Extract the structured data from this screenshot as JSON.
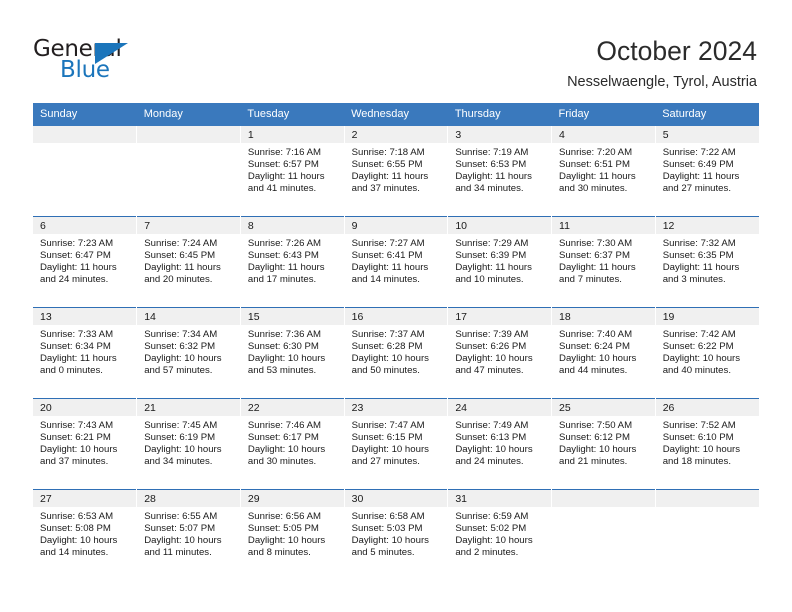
{
  "brand": {
    "name_primary": "General",
    "name_secondary": "Blue",
    "accent_color": "#1b75bb",
    "triangle_icon": "brand-triangle-icon"
  },
  "header": {
    "title": "October 2024",
    "subtitle": "Nesselwaengle, Tyrol, Austria"
  },
  "theme": {
    "header_row_bg": "#3a79bd",
    "week_divider": "#2f6fb5",
    "daynum_strip_bg": "#f0f0f0",
    "text_color": "#1a1a1a"
  },
  "weekdays": [
    "Sunday",
    "Monday",
    "Tuesday",
    "Wednesday",
    "Thursday",
    "Friday",
    "Saturday"
  ],
  "weeks": [
    [
      {
        "day": "",
        "empty": true,
        "sunrise": "",
        "sunset": "",
        "daylight_1": "",
        "daylight_2": ""
      },
      {
        "day": "",
        "empty": true,
        "sunrise": "",
        "sunset": "",
        "daylight_1": "",
        "daylight_2": ""
      },
      {
        "day": "1",
        "empty": false,
        "sunrise": "Sunrise: 7:16 AM",
        "sunset": "Sunset: 6:57 PM",
        "daylight_1": "Daylight: 11 hours",
        "daylight_2": "and 41 minutes."
      },
      {
        "day": "2",
        "empty": false,
        "sunrise": "Sunrise: 7:18 AM",
        "sunset": "Sunset: 6:55 PM",
        "daylight_1": "Daylight: 11 hours",
        "daylight_2": "and 37 minutes."
      },
      {
        "day": "3",
        "empty": false,
        "sunrise": "Sunrise: 7:19 AM",
        "sunset": "Sunset: 6:53 PM",
        "daylight_1": "Daylight: 11 hours",
        "daylight_2": "and 34 minutes."
      },
      {
        "day": "4",
        "empty": false,
        "sunrise": "Sunrise: 7:20 AM",
        "sunset": "Sunset: 6:51 PM",
        "daylight_1": "Daylight: 11 hours",
        "daylight_2": "and 30 minutes."
      },
      {
        "day": "5",
        "empty": false,
        "sunrise": "Sunrise: 7:22 AM",
        "sunset": "Sunset: 6:49 PM",
        "daylight_1": "Daylight: 11 hours",
        "daylight_2": "and 27 minutes."
      }
    ],
    [
      {
        "day": "6",
        "empty": false,
        "sunrise": "Sunrise: 7:23 AM",
        "sunset": "Sunset: 6:47 PM",
        "daylight_1": "Daylight: 11 hours",
        "daylight_2": "and 24 minutes."
      },
      {
        "day": "7",
        "empty": false,
        "sunrise": "Sunrise: 7:24 AM",
        "sunset": "Sunset: 6:45 PM",
        "daylight_1": "Daylight: 11 hours",
        "daylight_2": "and 20 minutes."
      },
      {
        "day": "8",
        "empty": false,
        "sunrise": "Sunrise: 7:26 AM",
        "sunset": "Sunset: 6:43 PM",
        "daylight_1": "Daylight: 11 hours",
        "daylight_2": "and 17 minutes."
      },
      {
        "day": "9",
        "empty": false,
        "sunrise": "Sunrise: 7:27 AM",
        "sunset": "Sunset: 6:41 PM",
        "daylight_1": "Daylight: 11 hours",
        "daylight_2": "and 14 minutes."
      },
      {
        "day": "10",
        "empty": false,
        "sunrise": "Sunrise: 7:29 AM",
        "sunset": "Sunset: 6:39 PM",
        "daylight_1": "Daylight: 11 hours",
        "daylight_2": "and 10 minutes."
      },
      {
        "day": "11",
        "empty": false,
        "sunrise": "Sunrise: 7:30 AM",
        "sunset": "Sunset: 6:37 PM",
        "daylight_1": "Daylight: 11 hours",
        "daylight_2": "and 7 minutes."
      },
      {
        "day": "12",
        "empty": false,
        "sunrise": "Sunrise: 7:32 AM",
        "sunset": "Sunset: 6:35 PM",
        "daylight_1": "Daylight: 11 hours",
        "daylight_2": "and 3 minutes."
      }
    ],
    [
      {
        "day": "13",
        "empty": false,
        "sunrise": "Sunrise: 7:33 AM",
        "sunset": "Sunset: 6:34 PM",
        "daylight_1": "Daylight: 11 hours",
        "daylight_2": "and 0 minutes."
      },
      {
        "day": "14",
        "empty": false,
        "sunrise": "Sunrise: 7:34 AM",
        "sunset": "Sunset: 6:32 PM",
        "daylight_1": "Daylight: 10 hours",
        "daylight_2": "and 57 minutes."
      },
      {
        "day": "15",
        "empty": false,
        "sunrise": "Sunrise: 7:36 AM",
        "sunset": "Sunset: 6:30 PM",
        "daylight_1": "Daylight: 10 hours",
        "daylight_2": "and 53 minutes."
      },
      {
        "day": "16",
        "empty": false,
        "sunrise": "Sunrise: 7:37 AM",
        "sunset": "Sunset: 6:28 PM",
        "daylight_1": "Daylight: 10 hours",
        "daylight_2": "and 50 minutes."
      },
      {
        "day": "17",
        "empty": false,
        "sunrise": "Sunrise: 7:39 AM",
        "sunset": "Sunset: 6:26 PM",
        "daylight_1": "Daylight: 10 hours",
        "daylight_2": "and 47 minutes."
      },
      {
        "day": "18",
        "empty": false,
        "sunrise": "Sunrise: 7:40 AM",
        "sunset": "Sunset: 6:24 PM",
        "daylight_1": "Daylight: 10 hours",
        "daylight_2": "and 44 minutes."
      },
      {
        "day": "19",
        "empty": false,
        "sunrise": "Sunrise: 7:42 AM",
        "sunset": "Sunset: 6:22 PM",
        "daylight_1": "Daylight: 10 hours",
        "daylight_2": "and 40 minutes."
      }
    ],
    [
      {
        "day": "20",
        "empty": false,
        "sunrise": "Sunrise: 7:43 AM",
        "sunset": "Sunset: 6:21 PM",
        "daylight_1": "Daylight: 10 hours",
        "daylight_2": "and 37 minutes."
      },
      {
        "day": "21",
        "empty": false,
        "sunrise": "Sunrise: 7:45 AM",
        "sunset": "Sunset: 6:19 PM",
        "daylight_1": "Daylight: 10 hours",
        "daylight_2": "and 34 minutes."
      },
      {
        "day": "22",
        "empty": false,
        "sunrise": "Sunrise: 7:46 AM",
        "sunset": "Sunset: 6:17 PM",
        "daylight_1": "Daylight: 10 hours",
        "daylight_2": "and 30 minutes."
      },
      {
        "day": "23",
        "empty": false,
        "sunrise": "Sunrise: 7:47 AM",
        "sunset": "Sunset: 6:15 PM",
        "daylight_1": "Daylight: 10 hours",
        "daylight_2": "and 27 minutes."
      },
      {
        "day": "24",
        "empty": false,
        "sunrise": "Sunrise: 7:49 AM",
        "sunset": "Sunset: 6:13 PM",
        "daylight_1": "Daylight: 10 hours",
        "daylight_2": "and 24 minutes."
      },
      {
        "day": "25",
        "empty": false,
        "sunrise": "Sunrise: 7:50 AM",
        "sunset": "Sunset: 6:12 PM",
        "daylight_1": "Daylight: 10 hours",
        "daylight_2": "and 21 minutes."
      },
      {
        "day": "26",
        "empty": false,
        "sunrise": "Sunrise: 7:52 AM",
        "sunset": "Sunset: 6:10 PM",
        "daylight_1": "Daylight: 10 hours",
        "daylight_2": "and 18 minutes."
      }
    ],
    [
      {
        "day": "27",
        "empty": false,
        "sunrise": "Sunrise: 6:53 AM",
        "sunset": "Sunset: 5:08 PM",
        "daylight_1": "Daylight: 10 hours",
        "daylight_2": "and 14 minutes."
      },
      {
        "day": "28",
        "empty": false,
        "sunrise": "Sunrise: 6:55 AM",
        "sunset": "Sunset: 5:07 PM",
        "daylight_1": "Daylight: 10 hours",
        "daylight_2": "and 11 minutes."
      },
      {
        "day": "29",
        "empty": false,
        "sunrise": "Sunrise: 6:56 AM",
        "sunset": "Sunset: 5:05 PM",
        "daylight_1": "Daylight: 10 hours",
        "daylight_2": "and 8 minutes."
      },
      {
        "day": "30",
        "empty": false,
        "sunrise": "Sunrise: 6:58 AM",
        "sunset": "Sunset: 5:03 PM",
        "daylight_1": "Daylight: 10 hours",
        "daylight_2": "and 5 minutes."
      },
      {
        "day": "31",
        "empty": false,
        "sunrise": "Sunrise: 6:59 AM",
        "sunset": "Sunset: 5:02 PM",
        "daylight_1": "Daylight: 10 hours",
        "daylight_2": "and 2 minutes."
      },
      {
        "day": "",
        "empty": true,
        "sunrise": "",
        "sunset": "",
        "daylight_1": "",
        "daylight_2": ""
      },
      {
        "day": "",
        "empty": true,
        "sunrise": "",
        "sunset": "",
        "daylight_1": "",
        "daylight_2": ""
      }
    ]
  ]
}
